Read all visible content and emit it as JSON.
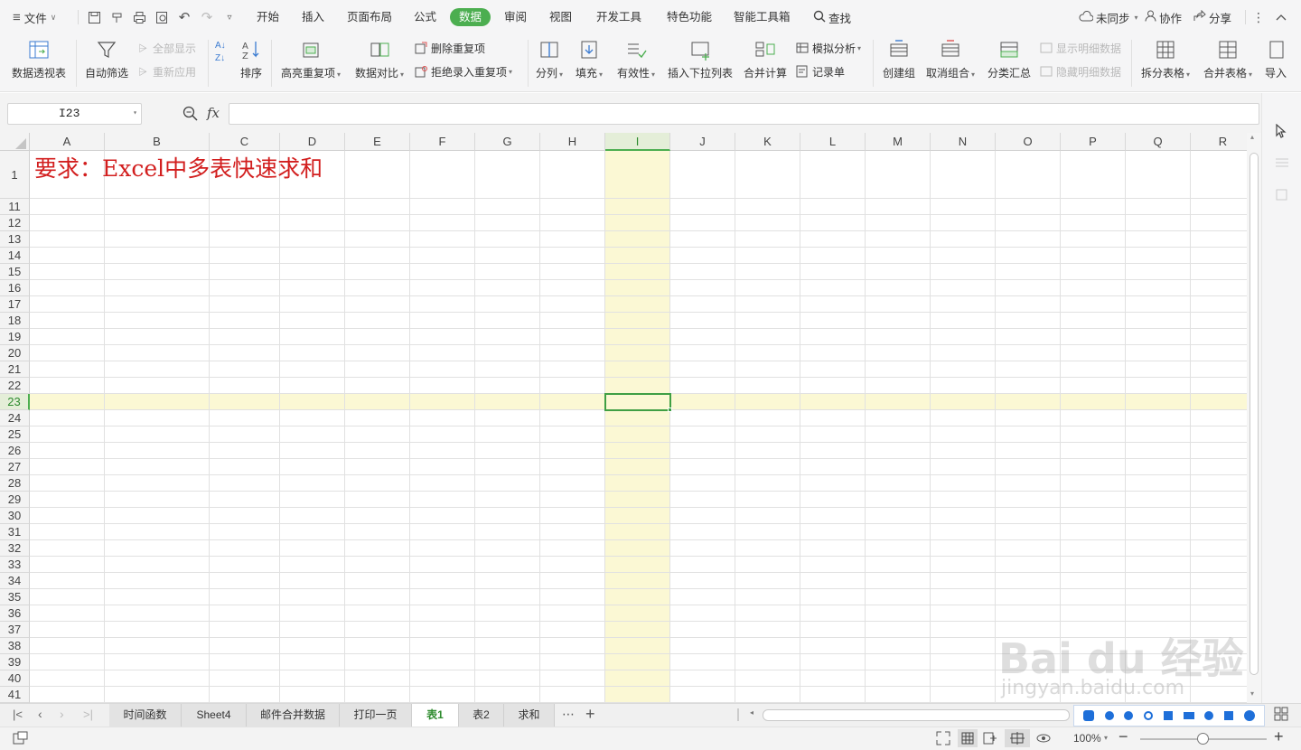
{
  "menubar": {
    "file_label": "文件",
    "tabs": [
      "开始",
      "插入",
      "页面布局",
      "公式",
      "数据",
      "审阅",
      "视图",
      "开发工具",
      "特色功能",
      "智能工具箱"
    ],
    "active_tab": "数据",
    "search_label": "查找",
    "sync_label": "未同步",
    "collab_label": "协作",
    "share_label": "分享"
  },
  "ribbon": {
    "pivot": "数据透视表",
    "autofilter": "自动筛选",
    "show_all": "全部显示",
    "reapply": "重新应用",
    "sort": "排序",
    "highlight_dup": "高亮重复项",
    "data_compare": "数据对比",
    "remove_dup": "删除重复项",
    "reject_dup": "拒绝录入重复项",
    "split_col": "分列",
    "fill": "填充",
    "validity": "有效性",
    "insert_dropdown": "插入下拉列表",
    "consolidate": "合并计算",
    "whatif": "模拟分析",
    "record_form": "记录单",
    "create_group": "创建组",
    "ungroup": "取消组合",
    "subtotal": "分类汇总",
    "show_detail": "显示明细数据",
    "hide_detail": "隐藏明细数据",
    "split_table": "拆分表格",
    "merge_table": "合并表格",
    "import": "导入"
  },
  "formula_bar": {
    "name_box": "I23",
    "fx_label": "fx",
    "formula": ""
  },
  "sheet": {
    "columns": [
      "A",
      "B",
      "C",
      "D",
      "E",
      "F",
      "G",
      "H",
      "I",
      "J",
      "K",
      "L",
      "M",
      "N",
      "O",
      "P",
      "Q",
      "R"
    ],
    "selected_column": "I",
    "rows": [
      "1",
      "11",
      "12",
      "13",
      "14",
      "15",
      "16",
      "17",
      "18",
      "19",
      "20",
      "21",
      "22",
      "23",
      "24",
      "25",
      "26",
      "27",
      "28",
      "29",
      "30",
      "31",
      "32",
      "33",
      "34",
      "35",
      "36",
      "37",
      "38",
      "39",
      "40",
      "41"
    ],
    "selected_row": "23",
    "cell_a1": "要求：Excel中多表快速求和"
  },
  "sheet_tabs": {
    "tabs": [
      "时间函数",
      "Sheet4",
      "邮件合并数据",
      "打印一页",
      "表1",
      "表2",
      "求和"
    ],
    "active": "表1",
    "more": "⋯",
    "add": "+"
  },
  "status": {
    "zoom": "100%"
  },
  "watermark": {
    "line1": "Bai du 经验",
    "line2": "jingyan.baidu.com"
  },
  "colors": {
    "accent": "#4cae50",
    "highlight": "#fbf8d4",
    "title_red": "#d21e1e"
  }
}
